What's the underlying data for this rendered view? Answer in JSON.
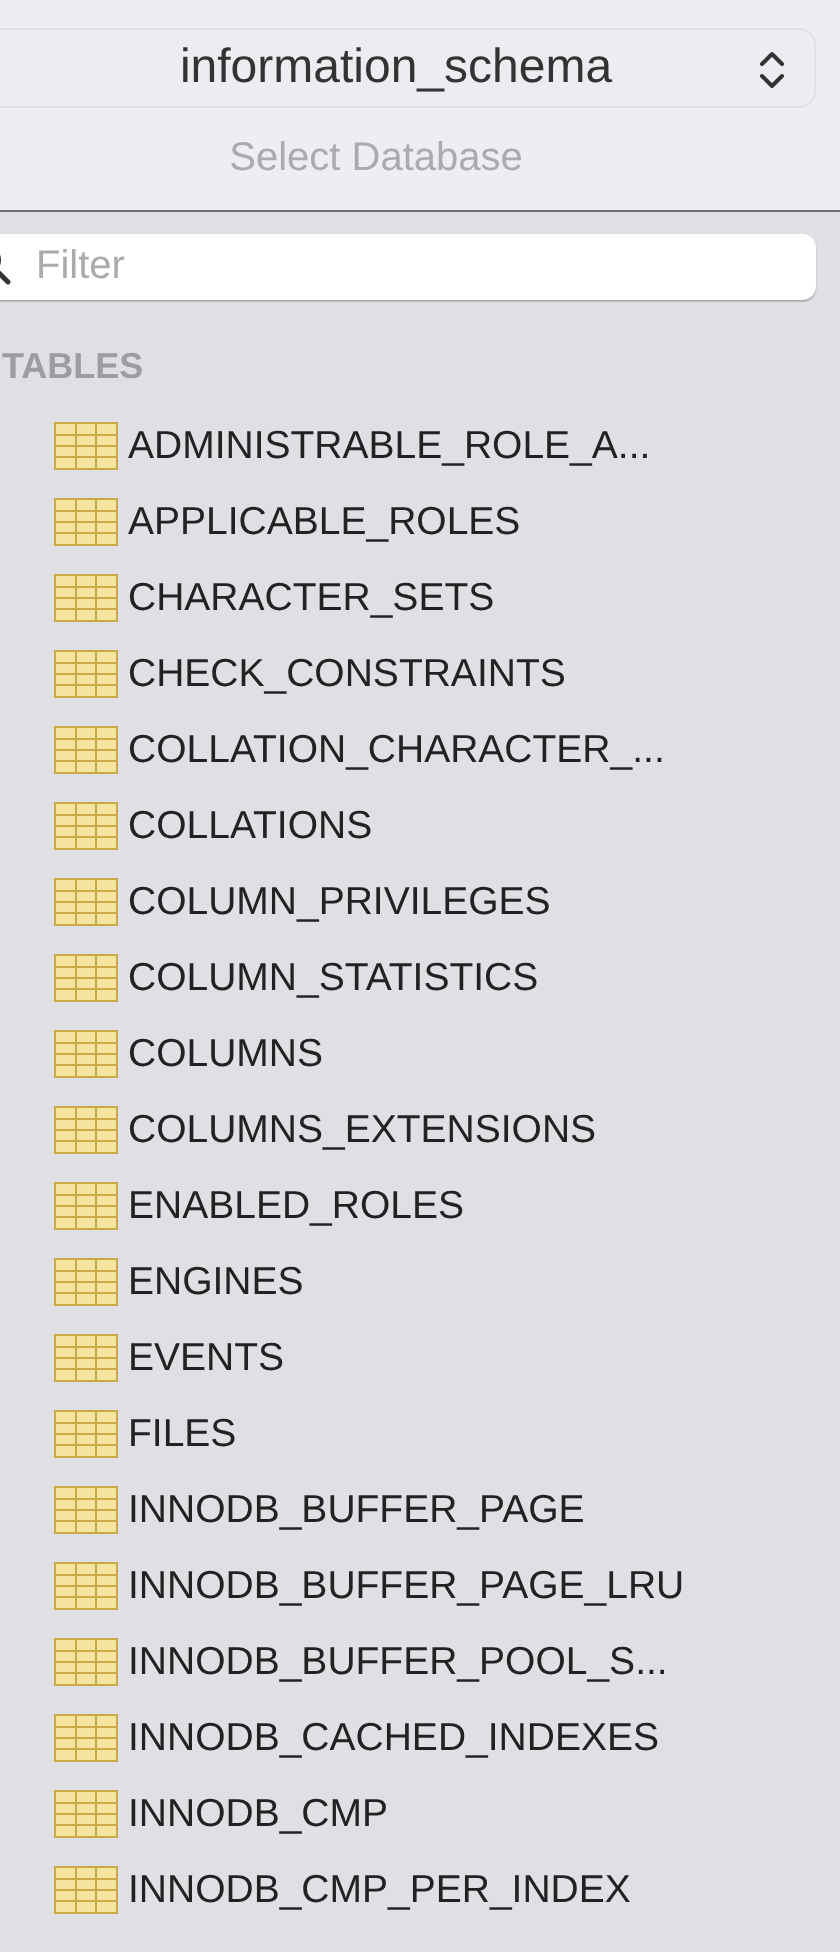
{
  "database_selector": {
    "value": "information_schema",
    "caption": "Select Database"
  },
  "filter": {
    "placeholder": "Filter"
  },
  "section_title": "TABLES",
  "tables": [
    {
      "name": "ADMINISTRABLE_ROLE_A..."
    },
    {
      "name": "APPLICABLE_ROLES"
    },
    {
      "name": "CHARACTER_SETS"
    },
    {
      "name": "CHECK_CONSTRAINTS"
    },
    {
      "name": "COLLATION_CHARACTER_..."
    },
    {
      "name": "COLLATIONS"
    },
    {
      "name": "COLUMN_PRIVILEGES"
    },
    {
      "name": "COLUMN_STATISTICS"
    },
    {
      "name": "COLUMNS"
    },
    {
      "name": "COLUMNS_EXTENSIONS"
    },
    {
      "name": "ENABLED_ROLES"
    },
    {
      "name": "ENGINES"
    },
    {
      "name": "EVENTS"
    },
    {
      "name": "FILES"
    },
    {
      "name": "INNODB_BUFFER_PAGE"
    },
    {
      "name": "INNODB_BUFFER_PAGE_LRU"
    },
    {
      "name": "INNODB_BUFFER_POOL_S..."
    },
    {
      "name": "INNODB_CACHED_INDEXES"
    },
    {
      "name": "INNODB_CMP"
    },
    {
      "name": "INNODB_CMP_PER_INDEX"
    }
  ]
}
